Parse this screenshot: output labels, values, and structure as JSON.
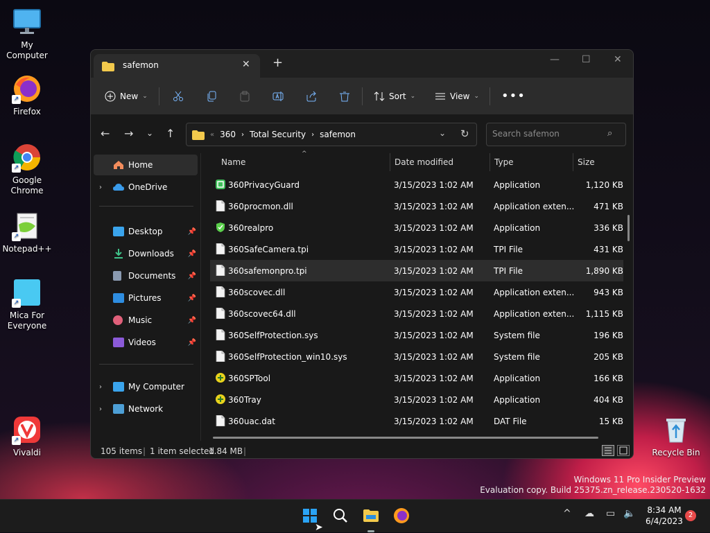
{
  "desktop": {
    "icons": [
      {
        "label": "My Computer"
      },
      {
        "label": "Firefox"
      },
      {
        "label": "Google Chrome"
      },
      {
        "label": "Notepad++"
      },
      {
        "label": "Mica For Everyone"
      },
      {
        "label": "Vivaldi"
      },
      {
        "label": "Recycle Bin"
      }
    ],
    "watermark": {
      "line1": "Windows 11 Pro Insider Preview",
      "line2": "Evaluation copy. Build 25375.zn_release.230520-1632"
    }
  },
  "explorer": {
    "tab_title": "safemon",
    "toolbar": {
      "new_label": "New",
      "sort_label": "Sort",
      "view_label": "View"
    },
    "breadcrumb": {
      "overflow": "«",
      "items": [
        "360",
        "Total Security",
        "safemon"
      ]
    },
    "search": {
      "placeholder": "Search safemon"
    },
    "sidebar": {
      "items": [
        {
          "label": "Home"
        },
        {
          "label": "OneDrive"
        },
        {
          "label": "Desktop"
        },
        {
          "label": "Downloads"
        },
        {
          "label": "Documents"
        },
        {
          "label": "Pictures"
        },
        {
          "label": "Music"
        },
        {
          "label": "Videos"
        },
        {
          "label": "My Computer"
        },
        {
          "label": "Network"
        }
      ]
    },
    "columns": {
      "name": "Name",
      "date": "Date modified",
      "type": "Type",
      "size": "Size"
    },
    "files": [
      {
        "name": "360PrivacyGuard",
        "date": "3/15/2023 1:02 AM",
        "type": "Application",
        "size": "1,120 KB"
      },
      {
        "name": "360procmon.dll",
        "date": "3/15/2023 1:02 AM",
        "type": "Application exten...",
        "size": "471 KB"
      },
      {
        "name": "360realpro",
        "date": "3/15/2023 1:02 AM",
        "type": "Application",
        "size": "336 KB"
      },
      {
        "name": "360SafeCamera.tpi",
        "date": "3/15/2023 1:02 AM",
        "type": "TPI File",
        "size": "431 KB"
      },
      {
        "name": "360safemonpro.tpi",
        "date": "3/15/2023 1:02 AM",
        "type": "TPI File",
        "size": "1,890 KB"
      },
      {
        "name": "360scovec.dll",
        "date": "3/15/2023 1:02 AM",
        "type": "Application exten...",
        "size": "943 KB"
      },
      {
        "name": "360scovec64.dll",
        "date": "3/15/2023 1:02 AM",
        "type": "Application exten...",
        "size": "1,115 KB"
      },
      {
        "name": "360SelfProtection.sys",
        "date": "3/15/2023 1:02 AM",
        "type": "System file",
        "size": "196 KB"
      },
      {
        "name": "360SelfProtection_win10.sys",
        "date": "3/15/2023 1:02 AM",
        "type": "System file",
        "size": "205 KB"
      },
      {
        "name": "360SPTool",
        "date": "3/15/2023 1:02 AM",
        "type": "Application",
        "size": "166 KB"
      },
      {
        "name": "360Tray",
        "date": "3/15/2023 1:02 AM",
        "type": "Application",
        "size": "404 KB"
      },
      {
        "name": "360uac.dat",
        "date": "3/15/2023 1:02 AM",
        "type": "DAT File",
        "size": "15 KB"
      }
    ],
    "status": {
      "count": "105 items",
      "selected": "1 item selected",
      "size": "1.84 MB"
    }
  },
  "taskbar": {
    "time": "8:34 AM",
    "date": "6/4/2023",
    "badge": "2"
  },
  "colors": {
    "accent": "#0078d4",
    "folder": "#f2c94c",
    "badge": "#e84a4a"
  }
}
